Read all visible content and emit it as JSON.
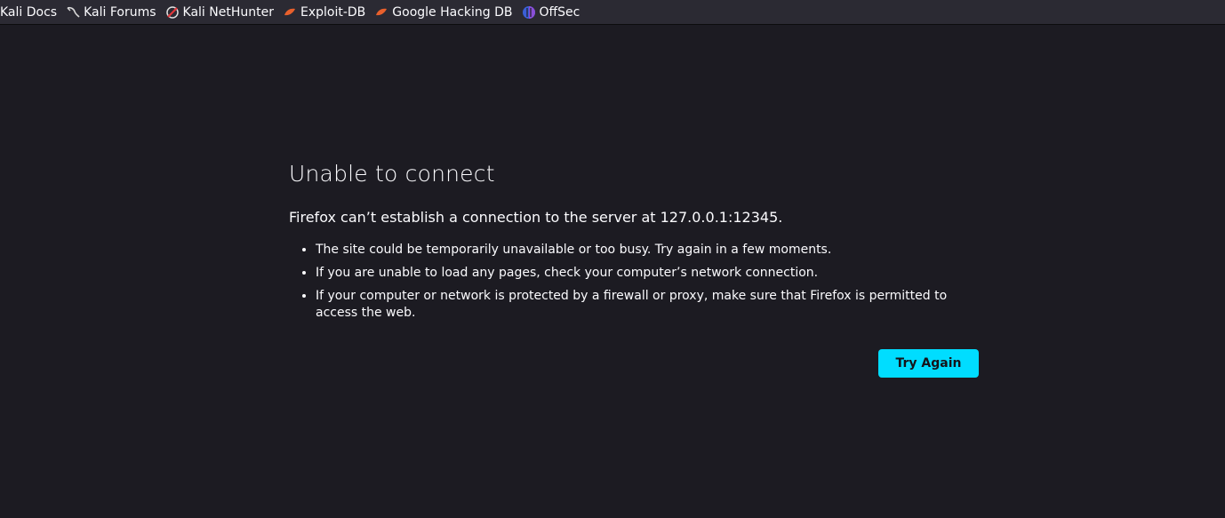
{
  "bookmarks": [
    {
      "label": "Kali Docs",
      "icon": "kali-docs-icon"
    },
    {
      "label": "Kali Forums",
      "icon": "kali-dragon-icon"
    },
    {
      "label": "Kali NetHunter",
      "icon": "nethunter-icon"
    },
    {
      "label": "Exploit-DB",
      "icon": "exploit-db-icon"
    },
    {
      "label": "Google Hacking DB",
      "icon": "exploit-db-icon"
    },
    {
      "label": "OffSec",
      "icon": "offsec-icon"
    }
  ],
  "error": {
    "title": "Unable to connect",
    "short_desc": "Firefox can’t establish a connection to the server at 127.0.0.1:12345.",
    "suggestions": [
      "The site could be temporarily unavailable or too busy. Try again in a few moments.",
      "If you are unable to load any pages, check your computer’s network connection.",
      "If your computer or network is protected by a firewall or proxy, make sure that Firefox is permitted to access the web."
    ],
    "button_label": "Try Again"
  },
  "colors": {
    "page_background": "#1c1b22",
    "toolbar_background": "#2b2a33",
    "accent_button": "#00ddff"
  }
}
